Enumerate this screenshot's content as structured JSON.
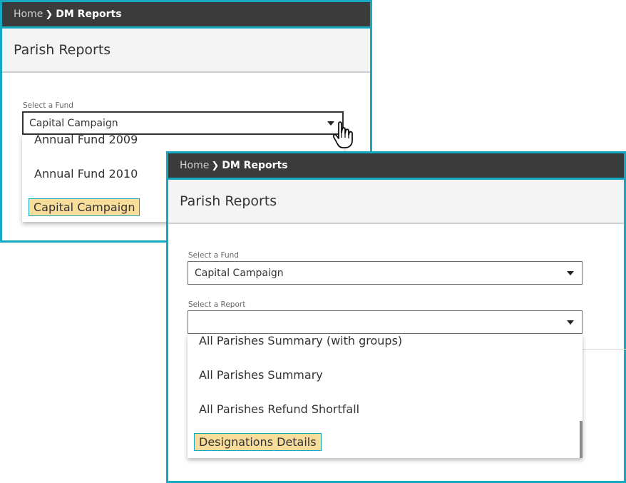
{
  "panel1": {
    "breadcrumb": {
      "home": "Home",
      "separator": "❯",
      "current": "DM Reports"
    },
    "page_title": "Parish Reports",
    "fund_select": {
      "label": "Select a Fund",
      "value": "Capital Campaign",
      "options": [
        "Annual Fund 2009",
        "Annual Fund 2010",
        "Capital Campaign"
      ],
      "highlighted": "Capital Campaign"
    }
  },
  "panel2": {
    "breadcrumb": {
      "home": "Home",
      "separator": "❯",
      "current": "DM Reports"
    },
    "page_title": "Parish Reports",
    "fund_select": {
      "label": "Select a Fund",
      "value": "Capital Campaign"
    },
    "report_select": {
      "label": "Select a Report",
      "value": "",
      "options": [
        "All Parishes Summary (with groups)",
        "All Parishes Summary",
        "All Parishes Refund Shortfall",
        "Designations Details"
      ],
      "highlighted": "Designations Details"
    }
  },
  "colors": {
    "accent_border": "#14a9c1",
    "topbar_bg": "#3b3b3b",
    "header_bg": "#f4f4f4",
    "highlight_bg": "#f7dc9a"
  },
  "icons": {
    "cursor": "hand-pointer-icon",
    "caret": "caret-down-icon",
    "separator": "chevron-right-icon"
  }
}
